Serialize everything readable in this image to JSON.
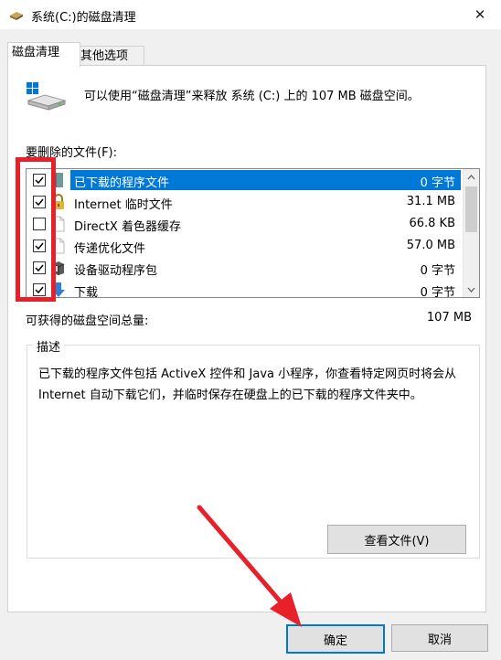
{
  "window": {
    "title": "系统(C:)的磁盘清理",
    "close_glyph": "✕"
  },
  "tabs": [
    {
      "label": "磁盘清理"
    },
    {
      "label": "其他选项"
    }
  ],
  "intro_text": "可以使用“磁盘清理”来释放 系统 (C:) 上的 107 MB 磁盘空间。",
  "files_label": "要删除的文件(F):",
  "files": [
    {
      "name": "已下载的程序文件",
      "size": "0 字节",
      "checked": true,
      "selected": true,
      "icon": "folder-icon"
    },
    {
      "name": "Internet 临时文件",
      "size": "31.1 MB",
      "checked": true,
      "selected": false,
      "icon": "lock-icon"
    },
    {
      "name": "DirectX 着色器缓存",
      "size": "66.8 KB",
      "checked": false,
      "selected": false,
      "icon": "file-icon"
    },
    {
      "name": "传递优化文件",
      "size": "57.0 MB",
      "checked": true,
      "selected": false,
      "icon": "file-icon"
    },
    {
      "name": "设备驱动程序包",
      "size": "0 字节",
      "checked": true,
      "selected": false,
      "icon": "driver-package-icon"
    },
    {
      "name": "下载",
      "size": "0 字节",
      "checked": true,
      "selected": false,
      "icon": "download-arrow-icon"
    }
  ],
  "total": {
    "label": "可获得的磁盘空间总量:",
    "value": "107 MB"
  },
  "description": {
    "legend": "描述",
    "text": "已下载的程序文件包括 ActiveX 控件和 Java 小程序，你查看特定网页时将会从 Internet 自动下载它们，并临时保存在硬盘上的已下载的程序文件夹中。",
    "view_files_button": "查看文件(V)"
  },
  "buttons": {
    "ok": "确定",
    "cancel": "取消"
  },
  "colors": {
    "selection": "#0078d7",
    "annotation_red": "#e8202a"
  }
}
